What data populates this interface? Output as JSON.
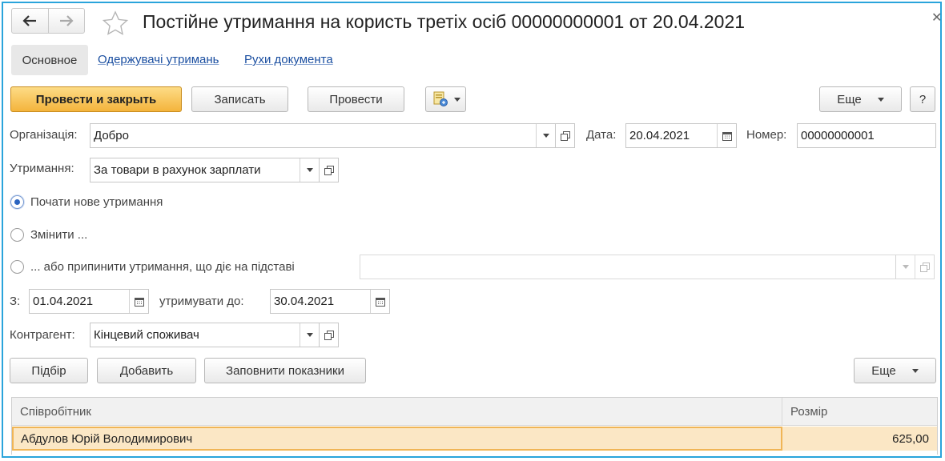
{
  "window": {
    "title": "Постійне утримання на користь третіх осіб 00000000001 от 20.04.2021"
  },
  "tabs": [
    {
      "label": "Основное",
      "active": true
    },
    {
      "label": "Одержувачі утримань",
      "active": false
    },
    {
      "label": "Рухи документа",
      "active": false
    }
  ],
  "toolbar": {
    "post_close": "Провести и закрыть",
    "save": "Записать",
    "post": "Провести",
    "more": "Еще",
    "help": "?"
  },
  "form": {
    "organization_label": "Організація:",
    "organization_value": "Добро",
    "date_label": "Дата:",
    "date_value": "20.04.2021",
    "number_label": "Номер:",
    "number_value": "00000000001",
    "deduction_label": "Утримання:",
    "deduction_value": "За товари в рахунок зарплати",
    "radio_new": "Почати нове утримання",
    "radio_change": "Змінити ...",
    "radio_stop": "... або припинити утримання, що діє на підставі",
    "stop_basis_value": "",
    "from_label": "З:",
    "from_value": "01.04.2021",
    "until_label": "утримувати до:",
    "until_value": "30.04.2021",
    "counterparty_label": "Контрагент:",
    "counterparty_value": "Кінцевий споживач"
  },
  "table_toolbar": {
    "pick": "Підбір",
    "add": "Добавить",
    "fill": "Заповнити показники",
    "more": "Еще"
  },
  "table": {
    "columns": [
      "Співробітник",
      "Розмір"
    ],
    "rows": [
      {
        "employee": "Абдулов Юрій Володимирович",
        "amount": "625,00"
      }
    ]
  },
  "colors": {
    "frame": "#2aa4db",
    "primary_button": "#f4b43c",
    "selected_row": "#fbe7c5",
    "link": "#1a4ea0"
  }
}
